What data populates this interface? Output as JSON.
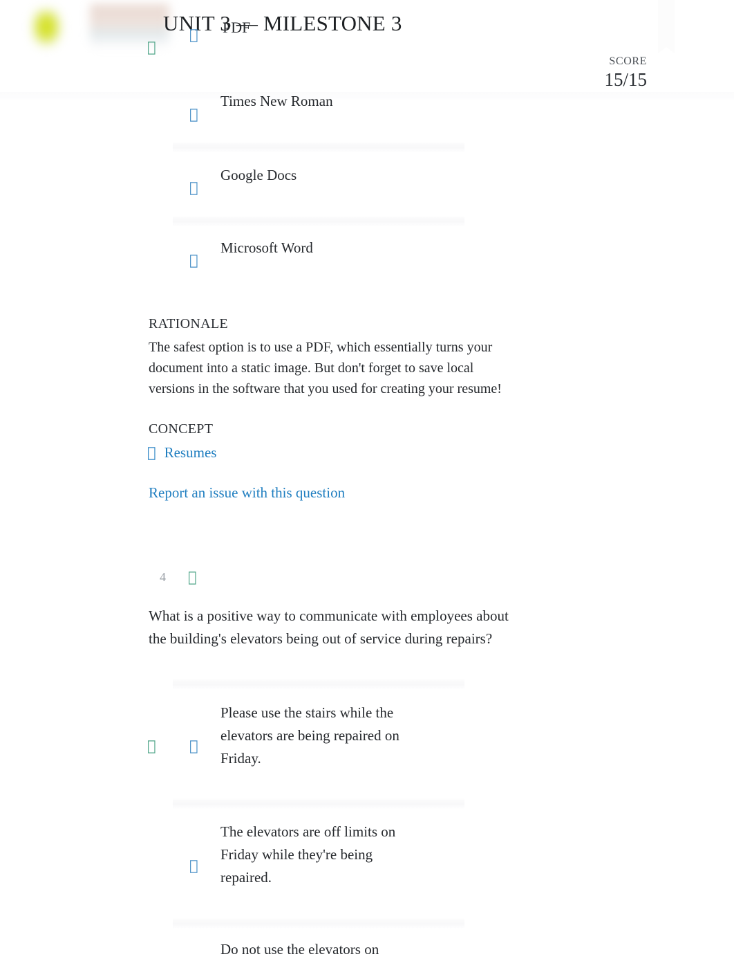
{
  "header": {
    "title": "UNIT 3 — MILESTONE 3",
    "bleed_option_text": "PDF",
    "score_label": "SCORE",
    "score_value": "15/15",
    "logo_alt": "sophia-logo",
    "icons": {
      "radio_tofu": "",
      "check_tofu": "",
      "bookmark": "bookmark-ribbon"
    }
  },
  "colors": {
    "link": "#1f7ec0",
    "radio": "#4a90c7",
    "correct": "#4fa588",
    "text": "#26292d",
    "muted": "#9aa0a6",
    "divider": "#f8f8f9"
  },
  "previous_question": {
    "options": [
      {
        "label": "PDF",
        "selected": true,
        "correct": true
      },
      {
        "label": "Times New Roman",
        "selected": false,
        "correct": false
      },
      {
        "label": "Google Docs",
        "selected": false,
        "correct": false
      },
      {
        "label": "Microsoft Word",
        "selected": false,
        "correct": false
      }
    ],
    "rationale_label": "RATIONALE",
    "rationale_text": "The safest option is to use a PDF, which essentially turns your document into a static image. But don't forget to save local versions in the software that you used for creating your resume!",
    "rationale_lines": [
      "The safest option is to use a PDF, which essentially turns your",
      "document into a static image. But don't forget to save local",
      "versions in the software that you used for creating your resume!"
    ],
    "concept_label": "CONCEPT",
    "concept_link": "Resumes",
    "report_link": "Report an issue with this question"
  },
  "question": {
    "number": "4",
    "text": "What is a positive way to communicate with employees about the building's elevators being out of service during repairs?",
    "lines": [
      "What is a positive way to communicate with employees about",
      "the building's elevators being out of service during repairs?"
    ],
    "options": [
      {
        "lines": [
          "Please use the stairs while the",
          "elevators are being repaired on",
          "Friday."
        ],
        "text": "Please use the stairs while the elevators are being repaired on Friday.",
        "selected": true,
        "correct": true
      },
      {
        "lines": [
          "The elevators are off limits on",
          "Friday while they're being",
          "repaired."
        ],
        "text": "The elevators are off limits on Friday while they're being repaired.",
        "selected": false,
        "correct": false
      },
      {
        "lines": [
          "Do not use the elevators on"
        ],
        "text": "Do not use the elevators on",
        "selected": false,
        "correct": false
      }
    ]
  }
}
